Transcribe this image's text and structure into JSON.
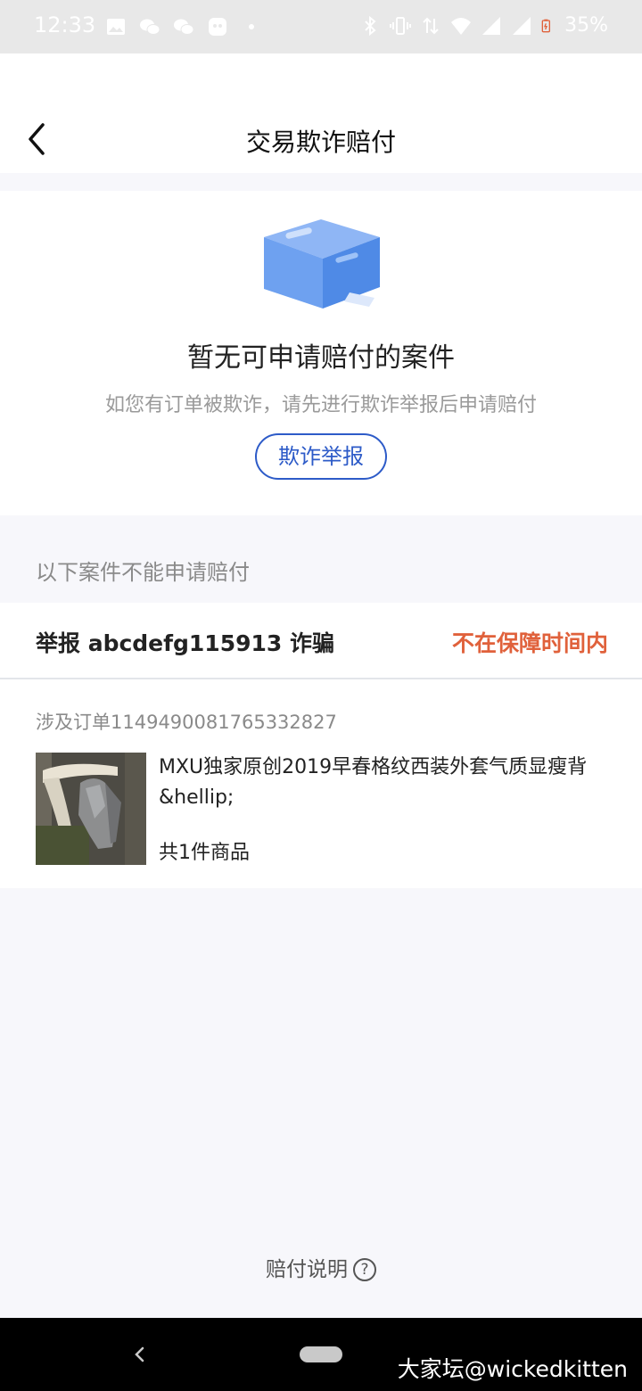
{
  "status_bar": {
    "time": "12:33",
    "battery": "35%",
    "left_icons": [
      "gallery-icon",
      "wechat-icon",
      "wechat-icon",
      "app-icon",
      "dot-icon"
    ],
    "right_icons": [
      "bluetooth-icon",
      "vibrate-icon",
      "data-arrows-icon",
      "wifi-icon",
      "signal-icon",
      "signal-roaming-icon",
      "battery-charging-icon"
    ]
  },
  "header": {
    "title": "交易欺诈赔付",
    "back_icon": "back-chevron-icon"
  },
  "empty_state": {
    "title": "暂无可申请赔付的案件",
    "description": "如您有订单被欺诈，请先进行欺诈举报后申请赔付",
    "button_label": "欺诈举报",
    "illustration": "empty-box-icon"
  },
  "section": {
    "label": "以下案件不能申请赔付"
  },
  "case": {
    "title": "举报 abcdefg115913 诈骗",
    "status": "不在保障时间内",
    "order_label": "涉及订单1149490081765332827",
    "product_name": "MXU独家原创2019早春格纹西装外套气质显瘦背&hellip;",
    "product_count": "共1件商品"
  },
  "footer": {
    "link_label": "赔付说明",
    "help_icon_glyph": "?"
  },
  "nav_bar": {
    "watermark": "大家坛@wickedkitten"
  },
  "colors": {
    "accent_blue": "#2d5bc8",
    "status_orange": "#e0613b",
    "page_background": "#f7f7fb"
  }
}
